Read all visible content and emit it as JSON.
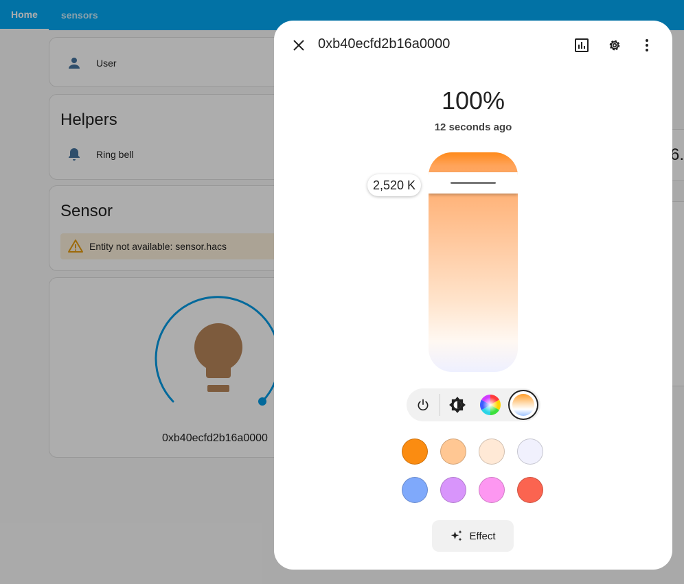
{
  "topbar": {
    "tabs": [
      "Home",
      "sensors"
    ]
  },
  "cards": {
    "user_row": {
      "label": "User",
      "icon": "account-icon"
    },
    "helpers": {
      "title": "Helpers",
      "row_label": "Ring bell",
      "icon": "bell-icon"
    },
    "sensor": {
      "title": "Sensor",
      "warning": "Entity not available: sensor.hacs",
      "icon": "warning-icon"
    },
    "light": {
      "name": "0xb40ecfd2b16a0000",
      "icon": "lightbulb-icon",
      "ring_color": "#039be5",
      "bulb_color": "#b8865a"
    },
    "peek_text": "6."
  },
  "dialog": {
    "title": "0xb40ecfd2b16a0000",
    "brightness": "100%",
    "last_changed": "12 seconds ago",
    "slider": {
      "value_label": "2,520 K",
      "handle_position": 0.9
    },
    "modes": [
      "power-icon",
      "brightness-icon",
      "color-wheel-icon",
      "color-temp-icon"
    ],
    "active_mode": "color-temp-icon",
    "swatches": [
      "#fb8c11",
      "#ffc793",
      "#ffe9d6",
      "#f1f1fd",
      "#7fa9fb",
      "#d895fb",
      "#fd97f1",
      "#fb6450"
    ],
    "effect_label": "Effect"
  }
}
